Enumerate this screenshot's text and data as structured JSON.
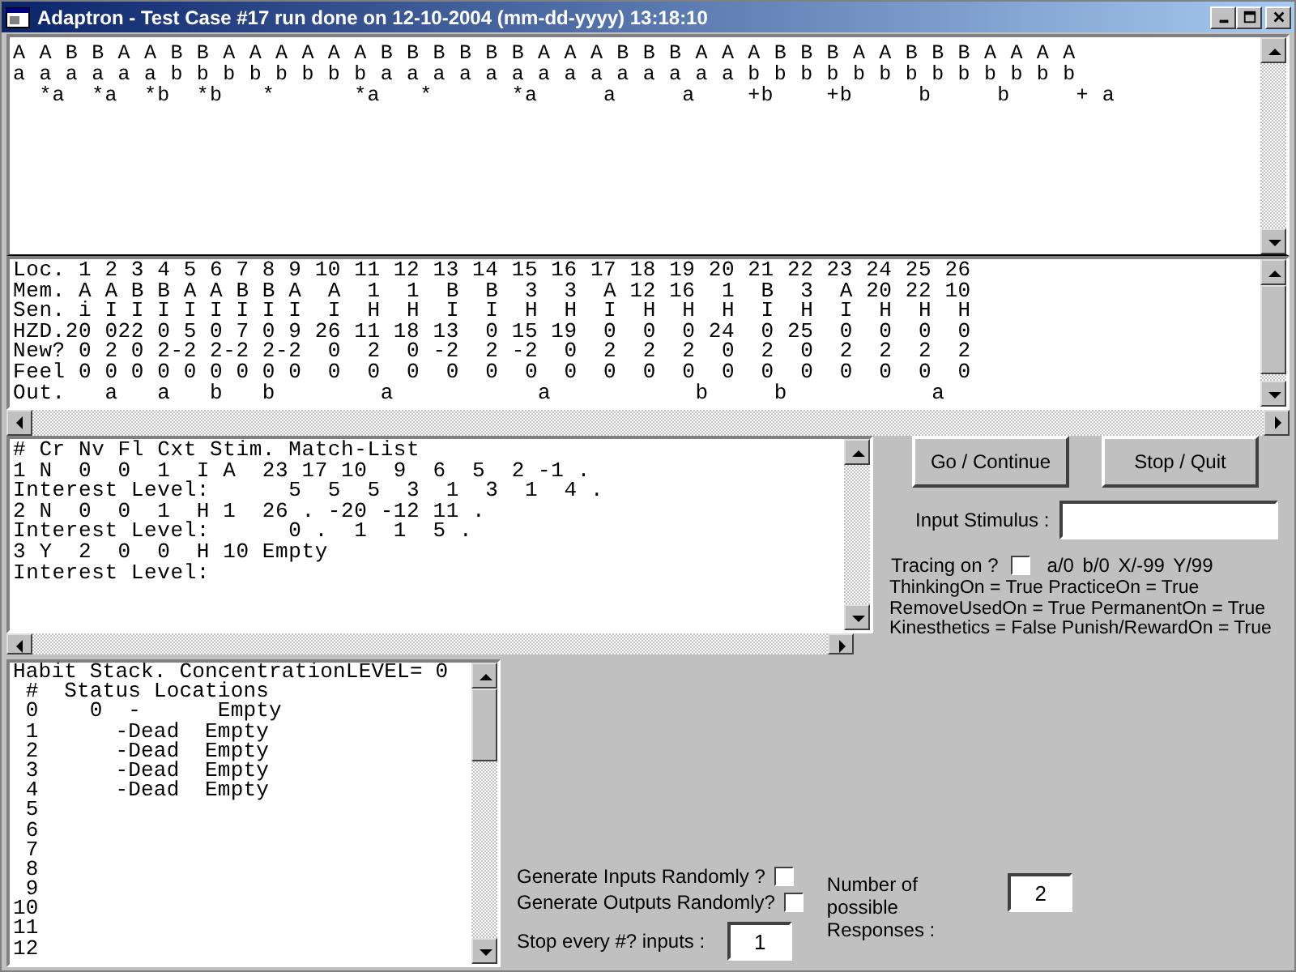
{
  "window": {
    "title": "Adaptron - Test Case #17 run done on 12-10-2004 (mm-dd-yyyy) 13:18:10"
  },
  "sequence_panel": {
    "lines": [
      "A A B B A A B B A A A A A A B B B B B B A A A B B B A A A B B B A A B B B A A A A",
      "a a a a a a b b b b b b b b a a a a a a a a a a a a a a b b b b b b b b b b b b b",
      "  *a  *a  *b  *b   *      *a   *      *a     a     a    +b    +b     b     b     + a"
    ]
  },
  "memory_table": {
    "lines": [
      "Loc. 1 2 3 4 5 6 7 8 9 10 11 12 13 14 15 16 17 18 19 20 21 22 23 24 25 26",
      "Mem. A A B B A A B B A  A  1  1  B  B  3  3  A 12 16  1  B  3  A 20 22 10",
      "Sen. i I I I I I I I I  I  H  H  I  I  H  H  I  H  H  H  I  H  I  H  H  H",
      "HZD.20 022 0 5 0 7 0 9 26 11 18 13  0 15 19  0  0  0 24  0 25  0  0  0  0",
      "New? 0 2 0 2-2 2-2 2-2  0  2  0 -2  2 -2  0  2  2  2  0  2  0  2  2  2  2",
      "Feel 0 0 0 0 0 0 0 0 0  0  0  0  0  0  0  0  0  0  0  0  0  0  0  0  0  0",
      "Out.   a   a   b   b        a           a           b     b           a"
    ]
  },
  "match_panel": {
    "lines": [
      "# Cr Nv Fl Cxt Stim. Match-List",
      "1 N  0  0  1  I A  23 17 10  9  6  5  2 -1 .",
      "Interest Level:      5  5  5  3  1  3  1  4 .",
      "2 N  0  0  1  H 1  26 . -20 -12 11 .",
      "Interest Level:      0 .  1  1  5 .",
      "3 Y  2  0  0  H 10 Empty",
      "Interest Level:"
    ]
  },
  "buttons": [
    {
      "label": "Go / Continue"
    },
    {
      "label": "Stop / Quit"
    }
  ],
  "input_stimulus": {
    "label": "Input Stimulus :"
  },
  "tracing": {
    "label": "Tracing on ?",
    "checked": false,
    "legend": "a/0  b/0  X/-99  Y/99"
  },
  "flags": [
    "ThinkingOn = True PracticeOn = True",
    "RemoveUsedOn = True PermanentOn = True",
    "Kinesthetics = False Punish/RewardOn = True"
  ],
  "habit_panel": {
    "lines": [
      "Habit Stack. ConcentrationLEVEL= 0",
      " #  Status Locations",
      " 0    0  -      Empty",
      " 1      -Dead  Empty",
      " 2      -Dead  Empty",
      " 3      -Dead  Empty",
      " 4      -Dead  Empty",
      " 5",
      " 6",
      " 7",
      " 8",
      " 9",
      "10",
      "11",
      "12"
    ]
  },
  "random_options": [
    {
      "label": "Generate Inputs Randomly ?",
      "checked": false
    },
    {
      "label": "Generate Outputs Randomly?",
      "checked": false
    }
  ],
  "responses": {
    "label": "Number of possible Responses :",
    "value": "2"
  },
  "stop_every": {
    "label": "Stop every #? inputs :",
    "value": "1"
  }
}
